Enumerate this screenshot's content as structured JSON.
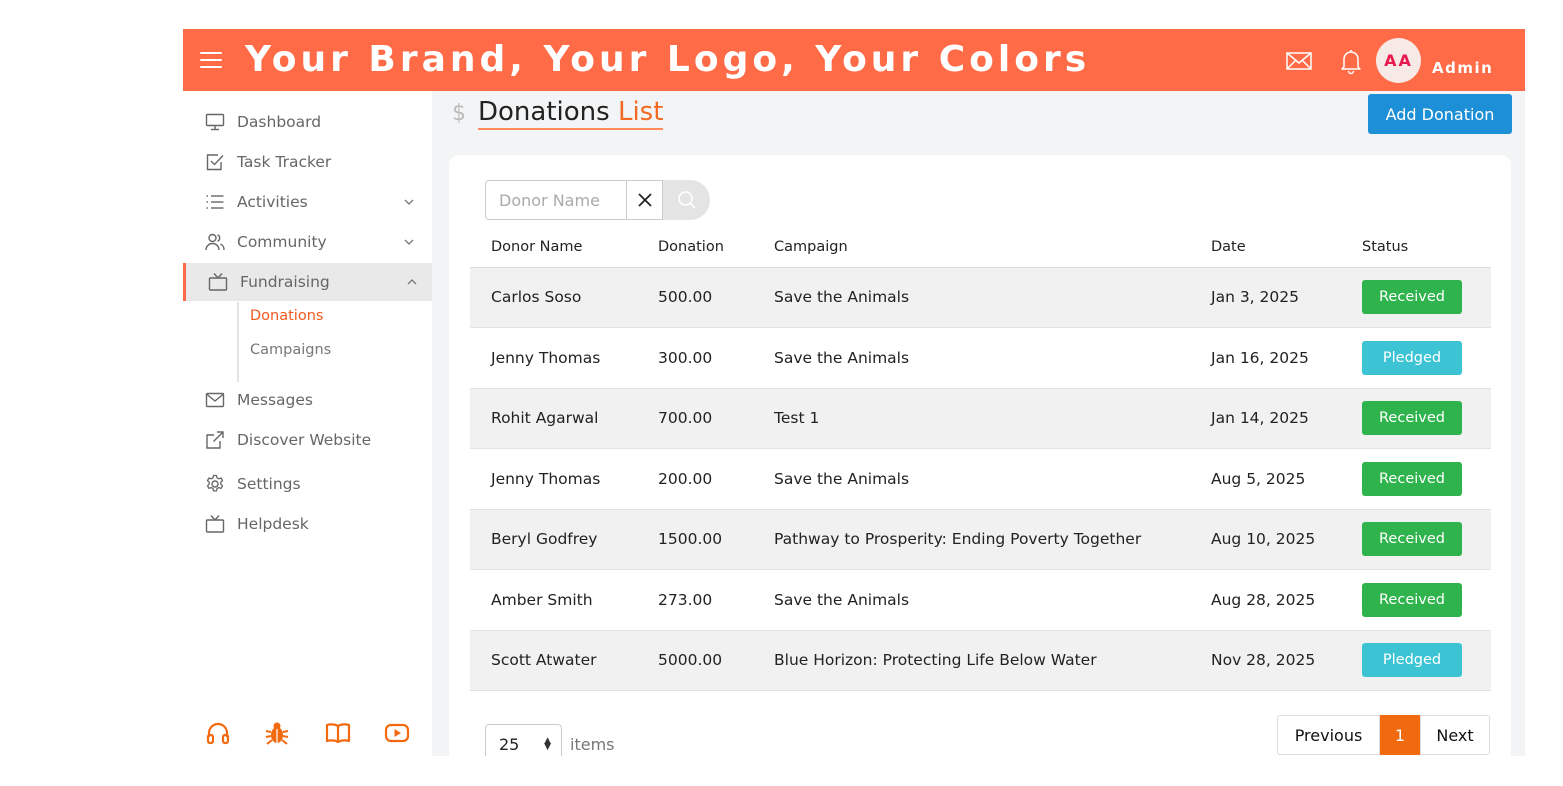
{
  "header": {
    "brand": "Your Brand, Your Logo, Your Colors",
    "avatar_initials": "AA",
    "user_name": "Admin",
    "color": "#ff6b47"
  },
  "sidebar": {
    "items": [
      {
        "label": "Dashboard",
        "icon": "monitor-icon"
      },
      {
        "label": "Task Tracker",
        "icon": "checkbox-icon"
      },
      {
        "label": "Activities",
        "icon": "list-icon"
      },
      {
        "label": "Community",
        "icon": "users-icon"
      },
      {
        "label": "Fundraising",
        "icon": "tv-icon"
      },
      {
        "label": "Messages",
        "icon": "mail-icon"
      },
      {
        "label": "Discover Website",
        "icon": "external-link-icon"
      },
      {
        "label": "Settings",
        "icon": "gear-icon"
      },
      {
        "label": "Helpdesk",
        "icon": "tv-icon"
      }
    ],
    "sub_items": [
      "Donations",
      "Campaigns"
    ],
    "footer_icons": [
      "headphones-icon",
      "bug-icon",
      "book-icon",
      "youtube-icon"
    ]
  },
  "page": {
    "title_main": "Donations",
    "title_accent": "List",
    "add_button": "Add Donation"
  },
  "search": {
    "placeholder": "Donor Name"
  },
  "table": {
    "columns": [
      "Donor Name",
      "Donation",
      "Campaign",
      "Date",
      "Status"
    ],
    "rows": [
      {
        "donor": "Carlos Soso",
        "donation": "500.00",
        "campaign": "Save the Animals",
        "date": "Jan 3, 2025",
        "status": "Received"
      },
      {
        "donor": "Jenny Thomas",
        "donation": "300.00",
        "campaign": "Save the Animals",
        "date": "Jan 16, 2025",
        "status": "Pledged"
      },
      {
        "donor": "Rohit Agarwal",
        "donation": "700.00",
        "campaign": "Test 1",
        "date": "Jan 14, 2025",
        "status": "Received"
      },
      {
        "donor": "Jenny Thomas",
        "donation": "200.00",
        "campaign": "Save the Animals",
        "date": "Aug 5, 2025",
        "status": "Received"
      },
      {
        "donor": "Beryl Godfrey",
        "donation": "1500.00",
        "campaign": "Pathway to Prosperity: Ending Poverty Together",
        "date": "Aug 10, 2025",
        "status": "Received"
      },
      {
        "donor": "Amber Smith",
        "donation": "273.00",
        "campaign": "Save the Animals",
        "date": "Aug 28, 2025",
        "status": "Received"
      },
      {
        "donor": "Scott Atwater",
        "donation": "5000.00",
        "campaign": "Blue Horizon: Protecting Life Below Water",
        "date": "Nov 28, 2025",
        "status": "Pledged"
      }
    ]
  },
  "pagination": {
    "per_page": "25",
    "items_label": "items",
    "previous": "Previous",
    "current": "1",
    "next": "Next"
  }
}
